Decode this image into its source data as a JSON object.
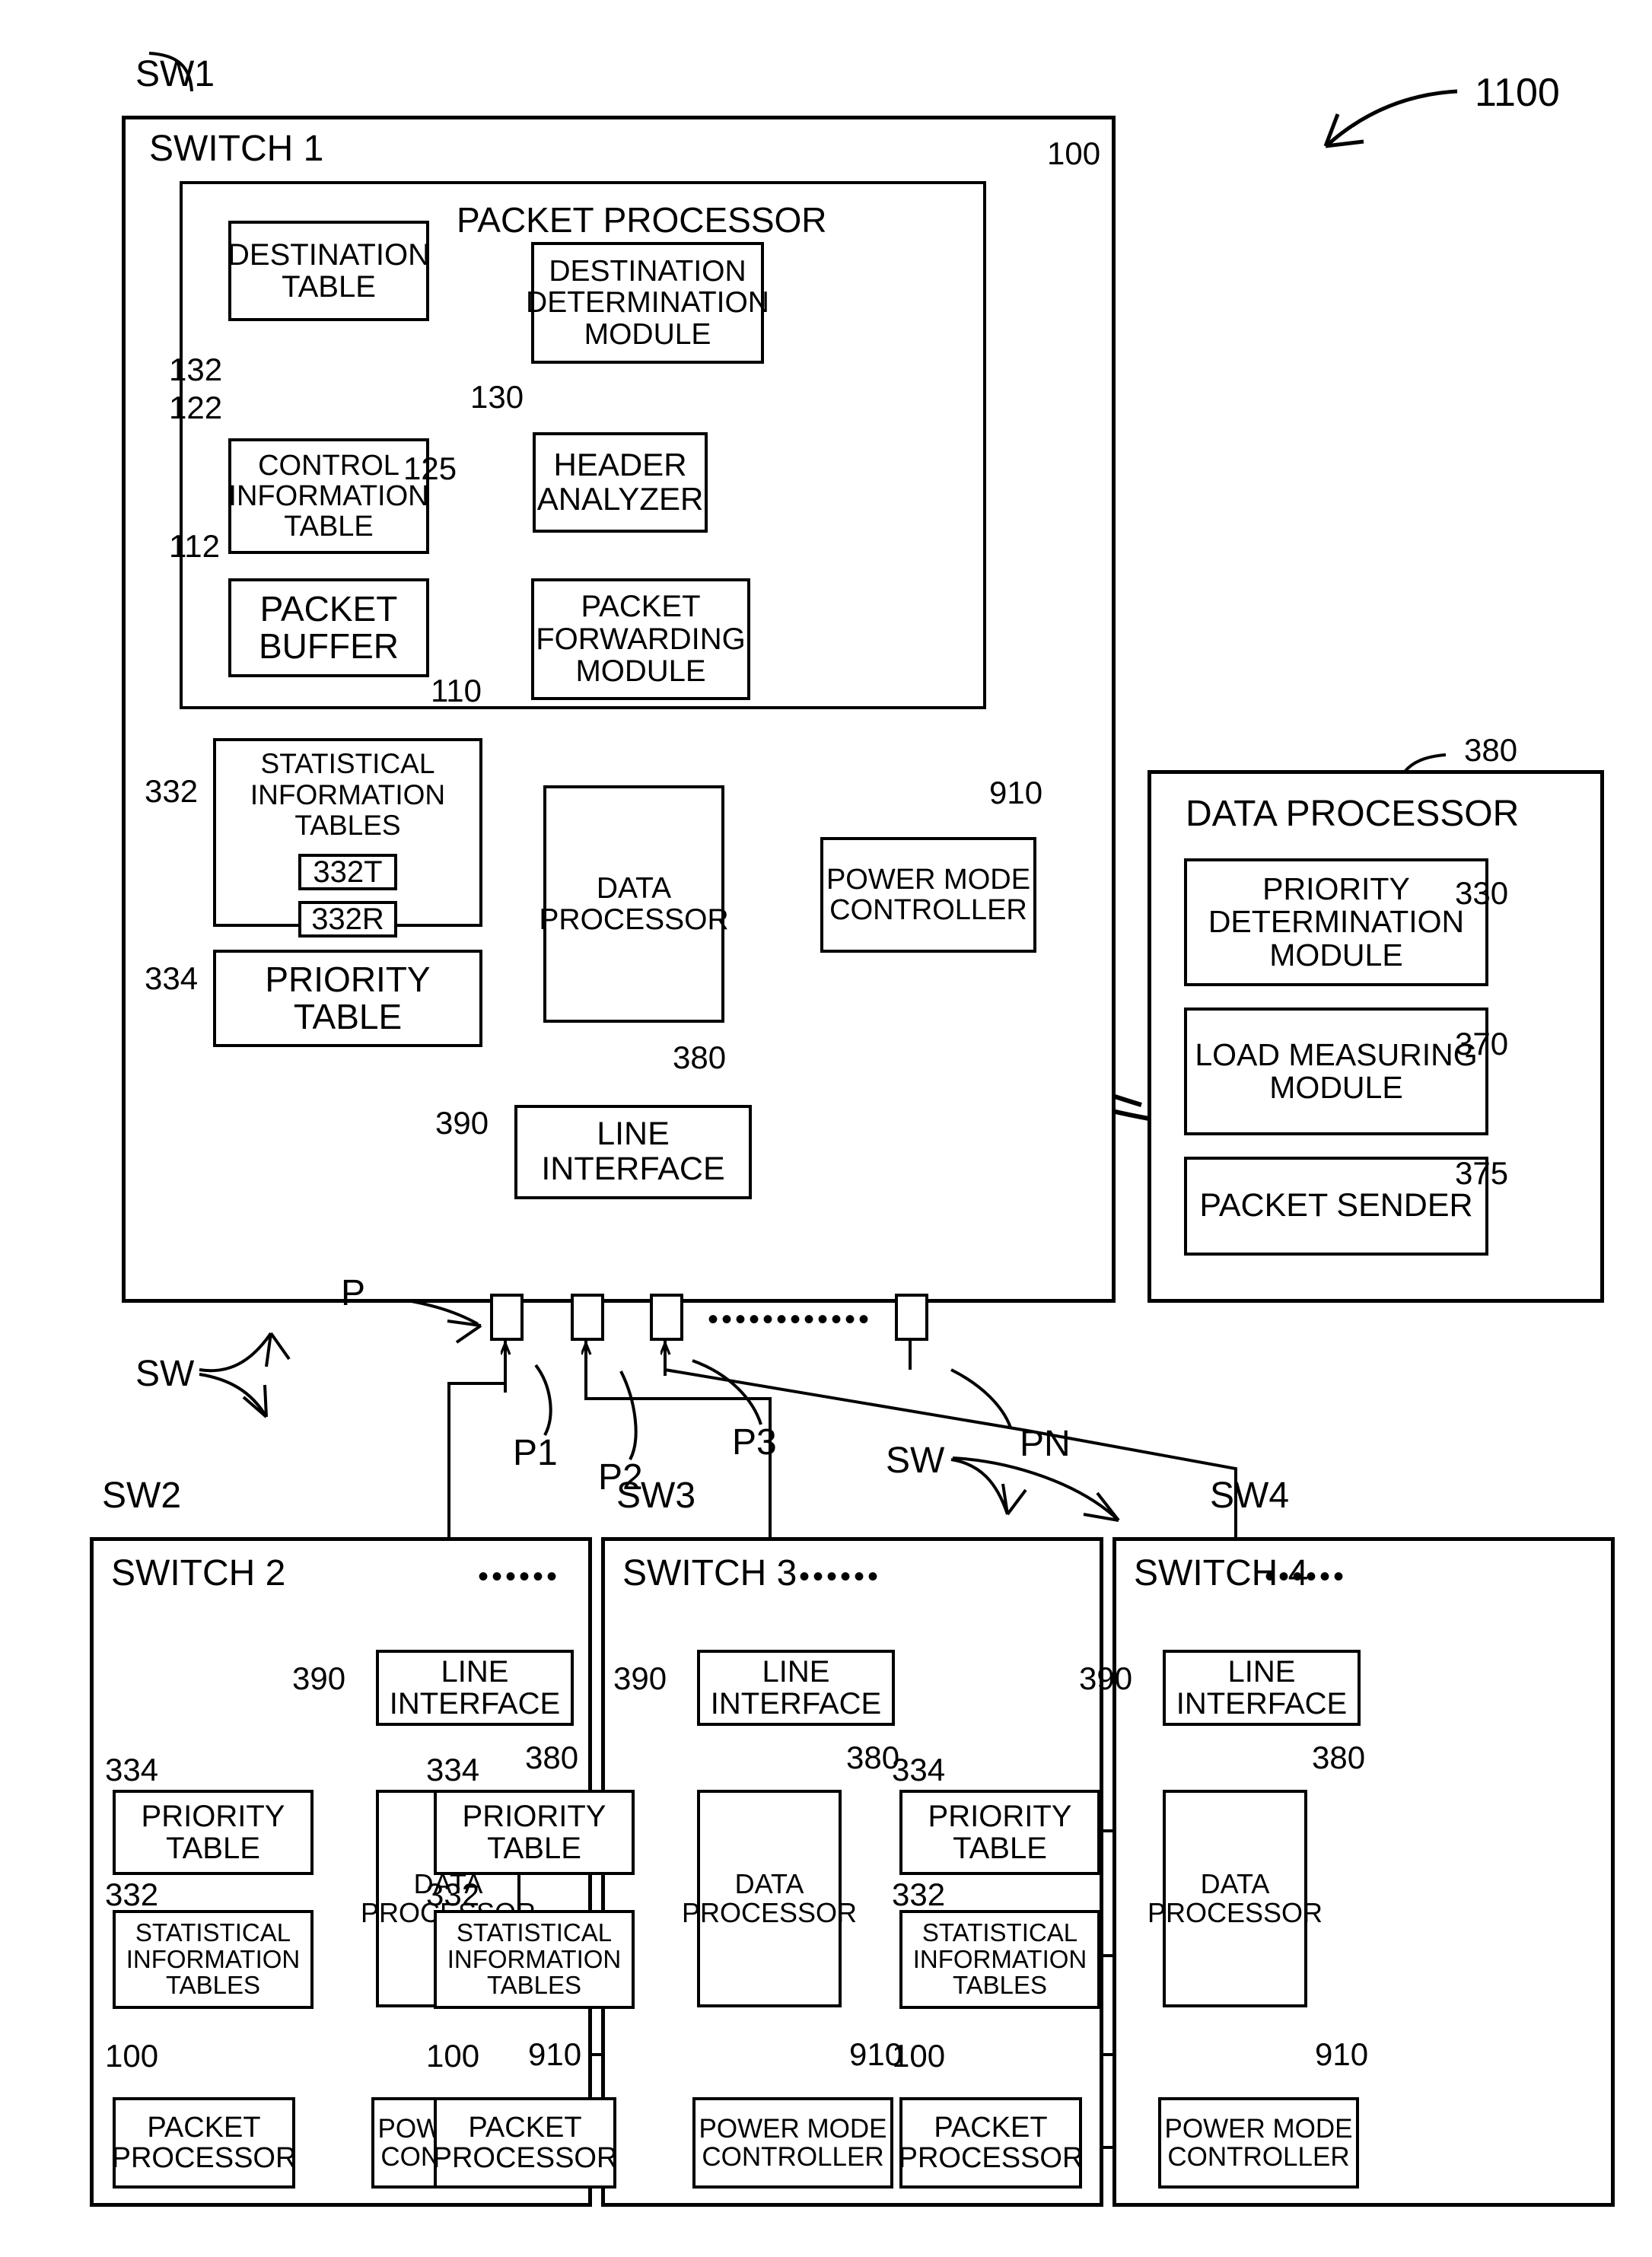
{
  "figure": {
    "ref": "1100"
  },
  "switch1": {
    "tag": "SW1",
    "title": "SWITCH 1",
    "ref_packet_processor": "100",
    "packet_processor": {
      "title": "PACKET PROCESSOR",
      "blocks": [
        {
          "label": "DESTINATION TABLE",
          "ref": "132"
        },
        {
          "label": "DESTINATION DETERMINATION MODULE",
          "ref": "130"
        },
        {
          "label": "CONTROL INFORMATION TABLE",
          "ref": "122"
        },
        {
          "label": "HEADER ANALYZER",
          "ref": "125"
        },
        {
          "label": "PACKET BUFFER",
          "ref": "112"
        },
        {
          "label": "PACKET FORWARDING MODULE",
          "ref": "110"
        }
      ]
    },
    "statistical_tables": {
      "label": "STATISTICAL INFORMATION TABLES",
      "ref": "332",
      "sub": [
        {
          "label": "332T"
        },
        {
          "label": "332R"
        }
      ]
    },
    "priority_table": {
      "label": "PRIORITY TABLE",
      "ref": "334"
    },
    "data_processor": {
      "label": "DATA PROCESSOR",
      "ref": "380"
    },
    "power_mode_controller": {
      "label": "POWER MODE CONTROLLER",
      "ref": "910"
    },
    "line_interface": {
      "label": "LINE INTERFACE",
      "ref": "390"
    },
    "ports": {
      "group_tag": "P",
      "labels": [
        "P1",
        "P2",
        "P3"
      ],
      "last_label": "PN",
      "ellipsis": "••••••••••••"
    }
  },
  "data_processor_detail": {
    "title": "DATA PROCESSOR",
    "ref": "380",
    "modules": [
      {
        "label": "PRIORITY DETERMINATION MODULE",
        "ref": "330"
      },
      {
        "label": "LOAD MEASURING MODULE",
        "ref": "370"
      },
      {
        "label": "PACKET SENDER",
        "ref": "375"
      }
    ]
  },
  "sw_group": {
    "tag_left": "SW",
    "tag_right": "SW"
  },
  "switches": [
    {
      "tag": "SW2",
      "title": "SWITCH 2",
      "ellipsis": "••••••",
      "line_interface": {
        "label": "LINE INTERFACE",
        "ref": "390"
      },
      "priority_table": {
        "label": "PRIORITY TABLE",
        "ref": "334"
      },
      "statistical_tables": {
        "label": "STATISTICAL INFORMATION TABLES",
        "ref": "332"
      },
      "data_processor": {
        "label": "DATA PROCESSOR",
        "ref": "380"
      },
      "packet_processor": {
        "label": "PACKET PROCESSOR",
        "ref": "100"
      },
      "power_mode_controller": {
        "label": "POWER MODE CONTROLLER",
        "ref": "910"
      }
    },
    {
      "tag": "SW3",
      "title": "SWITCH 3",
      "ellipsis": "••••••",
      "line_interface": {
        "label": "LINE INTERFACE",
        "ref": "390"
      },
      "priority_table": {
        "label": "PRIORITY TABLE",
        "ref": "334"
      },
      "statistical_tables": {
        "label": "STATISTICAL INFORMATION TABLES",
        "ref": "332"
      },
      "data_processor": {
        "label": "DATA PROCESSOR",
        "ref": "380"
      },
      "packet_processor": {
        "label": "PACKET PROCESSOR",
        "ref": "100"
      },
      "power_mode_controller": {
        "label": "POWER MODE CONTROLLER",
        "ref": "910"
      }
    },
    {
      "tag": "SW4",
      "title": "SWITCH 4",
      "ellipsis": "••••••",
      "line_interface": {
        "label": "LINE INTERFACE",
        "ref": "390"
      },
      "priority_table": {
        "label": "PRIORITY TABLE",
        "ref": "334"
      },
      "statistical_tables": {
        "label": "STATISTICAL INFORMATION TABLES",
        "ref": "332"
      },
      "data_processor": {
        "label": "DATA PROCESSOR",
        "ref": "380"
      },
      "packet_processor": {
        "label": "PACKET PROCESSOR",
        "ref": "100"
      },
      "power_mode_controller": {
        "label": "POWER MODE CONTROLLER",
        "ref": "910"
      }
    }
  ]
}
